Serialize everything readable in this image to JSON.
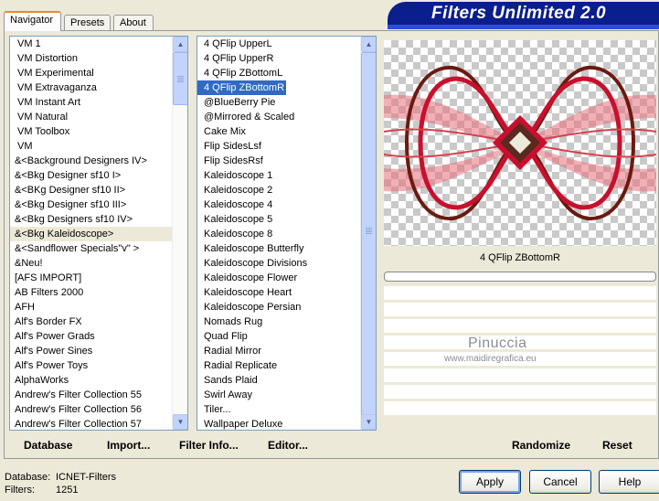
{
  "tabs": [
    "Navigator",
    "Presets",
    "About"
  ],
  "app_title": "Filters Unlimited 2.0",
  "categories": [
    "VM 1",
    "VM Distortion",
    "VM Experimental",
    "VM Extravaganza",
    "VM Instant Art",
    "VM Natural",
    "VM Toolbox",
    "VM",
    "&<Background Designers IV>",
    "&<Bkg Designer sf10 I>",
    "&<BKg Designer sf10 II>",
    "&<Bkg Designer sf10 III>",
    "&<Bkg Designers sf10 IV>",
    "&<Bkg Kaleidoscope>",
    "&<Sandflower Specials\"v\" >",
    "&Neu!",
    "[AFS IMPORT]",
    "AB Filters 2000",
    "AFH",
    "Alf's Border FX",
    "Alf's Power Grads",
    "Alf's Power Sines",
    "Alf's Power Toys",
    "AlphaWorks",
    "Andrew's Filter Collection 55",
    "Andrew's Filter Collection 56",
    "Andrew's Filter Collection 57"
  ],
  "selected_category": "&<Bkg Kaleidoscope>",
  "filters": [
    "4 QFlip UpperL",
    "4 QFlip UpperR",
    "4 QFlip ZBottomL",
    "4 QFlip ZBottomR",
    "@BlueBerry Pie",
    "@Mirrored & Scaled",
    "Cake Mix",
    "Flip SidesLsf",
    "Flip SidesRsf",
    "Kaleidoscope 1",
    "Kaleidoscope 2",
    "Kaleidoscope 4",
    "Kaleidoscope 5",
    "Kaleidoscope 8",
    "Kaleidoscope Butterfly",
    "Kaleidoscope Divisions",
    "Kaleidoscope Flower",
    "Kaleidoscope Heart",
    "Kaleidoscope Persian",
    "Nomads Rug",
    "Quad Flip",
    "Radial Mirror",
    "Radial Replicate",
    "Sands Plaid",
    "Swirl Away",
    "Tiler...",
    "Wallpaper Deluxe"
  ],
  "selected_filter": "4 QFlip ZBottomR",
  "preview_filter_name": "4 QFlip ZBottomR",
  "watermark": {
    "name": "Pinuccia",
    "url": "www.maidiregrafica.eu"
  },
  "links": {
    "database": "Database",
    "import": "Import...",
    "filter_info": "Filter Info...",
    "editor": "Editor...",
    "randomize": "Randomize",
    "reset": "Reset"
  },
  "status": {
    "database_label": "Database:",
    "database_value": "ICNET-Filters",
    "filters_label": "Filters:",
    "filters_value": "1251"
  },
  "buttons": {
    "apply": "Apply",
    "cancel": "Cancel",
    "help": "Help"
  },
  "colors": {
    "accent": "#316ac5",
    "header": "#0a1e8c",
    "preview_red": "#c8102e",
    "preview_brown": "#5a2a20"
  }
}
